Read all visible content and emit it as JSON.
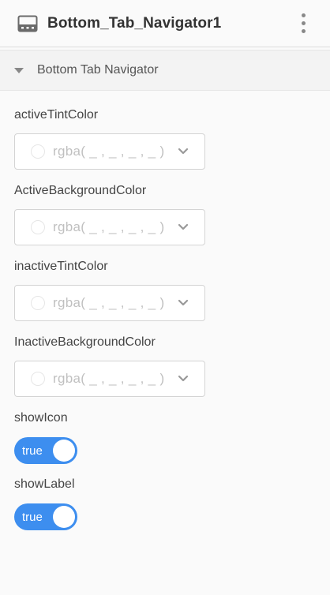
{
  "header": {
    "title": "Bottom_Tab_Navigator1",
    "icon": "bottom-tab-navigator-icon",
    "menu_icon": "more-vertical-icon"
  },
  "section": {
    "title": "Bottom Tab Navigator",
    "expanded": true
  },
  "colors": {
    "toggle_on": "#3d8eef",
    "placeholder_text": "#c0c0c0"
  },
  "props": {
    "activeTintColor": {
      "label": "activeTintColor",
      "value": "rgba( _ , _ , _ , _ )"
    },
    "activeBackgroundColor": {
      "label": "ActiveBackgroundColor",
      "value": "rgba( _ , _ , _ , _ )"
    },
    "inactiveTintColor": {
      "label": "inactiveTintColor",
      "value": "rgba( _ , _ , _ , _ )"
    },
    "inactiveBackgroundColor": {
      "label": "InactiveBackgroundColor",
      "value": "rgba( _ , _ , _ , _ )"
    },
    "showIcon": {
      "label": "showIcon",
      "value": "true"
    },
    "showLabel": {
      "label": "showLabel",
      "value": "true"
    }
  }
}
